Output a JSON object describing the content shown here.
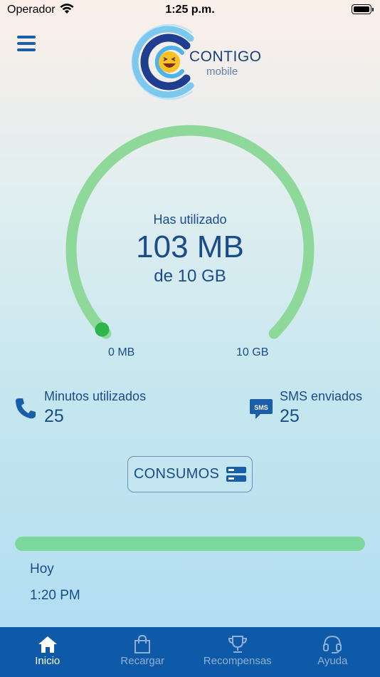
{
  "status_bar": {
    "carrier": "Operador",
    "time": "1:25 p.m."
  },
  "logo": {
    "brand": "CONTIGO",
    "sub": "mobile"
  },
  "gauge": {
    "top_label": "Has utilizado",
    "used": "103 MB",
    "total_label": "de 10 GB",
    "min_label": "0 MB",
    "max_label": "10 GB",
    "used_fraction": 0.01,
    "colors": {
      "track": "#8ed89a",
      "indicator": "#2bb54a"
    }
  },
  "stats": {
    "minutes": {
      "label": "Minutos utilizados",
      "value": "25"
    },
    "sms": {
      "label": "SMS enviados",
      "value": "25"
    }
  },
  "consumos_button": {
    "label": "CONSUMOS"
  },
  "history": {
    "progress_fraction": 1.0,
    "day": "Hoy",
    "time": "1:20 PM"
  },
  "tabs": [
    {
      "label": "Inicio",
      "icon": "home-icon",
      "active": true
    },
    {
      "label": "Recargar",
      "icon": "bag-icon",
      "active": false
    },
    {
      "label": "Recompensas",
      "icon": "trophy-icon",
      "active": false
    },
    {
      "label": "Ayuda",
      "icon": "headset-icon",
      "active": false
    }
  ],
  "colors": {
    "accent": "#1a5da8",
    "tabbar": "#0e5aa8",
    "text": "#1a4c8c"
  }
}
